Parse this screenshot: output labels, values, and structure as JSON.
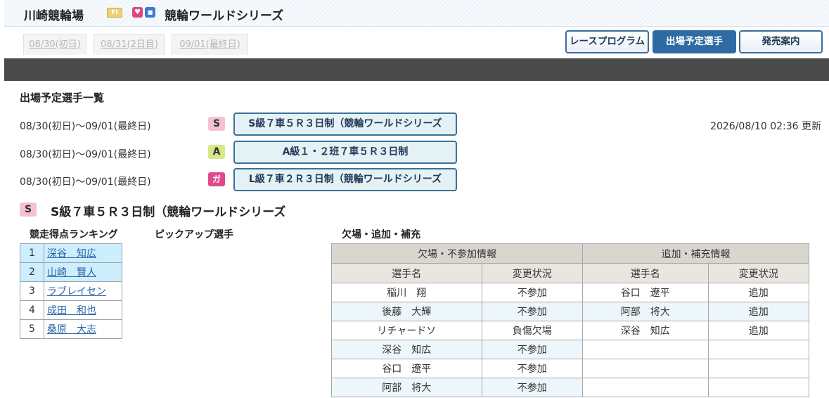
{
  "header": {
    "venue": "川崎競輪場",
    "grade_badge": "FI",
    "series_title": "競輪ワールドシリーズ"
  },
  "date_tabs": [
    {
      "label": "08/30(初日)"
    },
    {
      "label": "08/31(2日目)"
    },
    {
      "label": "09/01(最終日)"
    }
  ],
  "nav": {
    "race_program": "レースプログラム",
    "entries": "出場予定選手",
    "sales_info": "発売案内"
  },
  "page_title": "出場予定選手一覧",
  "updated": "2026/08/10 02:36 更新",
  "races": [
    {
      "dates": "08/30(初日)〜09/01(最終日)",
      "badge": "S",
      "label": "S級７車５Ｒ３日制（競輪ワールドシリーズ"
    },
    {
      "dates": "08/30(初日)〜09/01(最終日)",
      "badge": "A",
      "label": "A級１・２班７車５Ｒ３日制"
    },
    {
      "dates": "08/30(初日)〜09/01(最終日)",
      "badge": "ガ",
      "label": "L級７車２Ｒ３日制（競輪ワールドシリーズ"
    }
  ],
  "selected_race": {
    "badge": "S",
    "title": "S級７車５Ｒ３日制（競輪ワールドシリーズ"
  },
  "labels": {
    "ranking": "競走得点ランキング",
    "pickup": "ピックアップ選手",
    "absences": "欠場・追加・補充"
  },
  "ranking": [
    {
      "rank": "1",
      "name": "深谷　知広"
    },
    {
      "rank": "2",
      "name": "山崎　賢人"
    },
    {
      "rank": "3",
      "name": "ラブレイセン"
    },
    {
      "rank": "4",
      "name": "成田　和也"
    },
    {
      "rank": "5",
      "name": "桑原　大志"
    }
  ],
  "absent_table": {
    "group_left": "欠場・不参加情報",
    "group_right": "追加・補充情報",
    "col_name": "選手名",
    "col_status": "変更状況",
    "rows": [
      {
        "out_name": "稲川　翔",
        "out_status": "不参加",
        "in_name": "谷口　遼平",
        "in_status": "追加"
      },
      {
        "out_name": "後藤　大輝",
        "out_status": "不参加",
        "in_name": "阿部　将大",
        "in_status": "追加"
      },
      {
        "out_name": "リチャードソ",
        "out_status": "負傷欠場",
        "in_name": "深谷　知広",
        "in_status": "追加"
      },
      {
        "out_name": "深谷　知広",
        "out_status": "不参加",
        "in_name": "",
        "in_status": ""
      },
      {
        "out_name": "谷口　遼平",
        "out_status": "不参加",
        "in_name": "",
        "in_status": ""
      },
      {
        "out_name": "阿部　将大",
        "out_status": "不参加",
        "in_name": "",
        "in_status": ""
      }
    ]
  }
}
